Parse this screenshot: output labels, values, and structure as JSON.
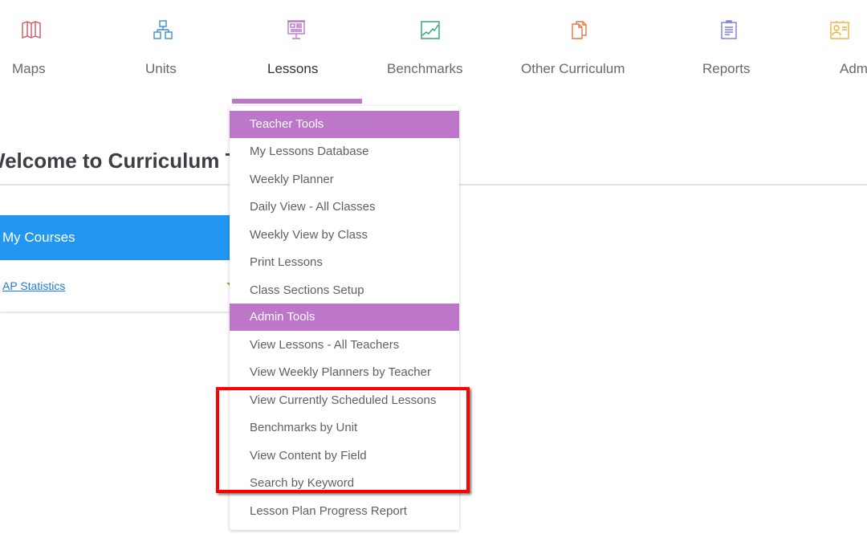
{
  "nav": {
    "items": [
      {
        "label": "Maps",
        "icon": "map-icon",
        "color": "#d9525e"
      },
      {
        "label": "Units",
        "icon": "hierarchy-icon",
        "color": "#3d8fd1"
      },
      {
        "label": "Lessons",
        "icon": "presentation-board-icon",
        "color": "#bc77c8",
        "active": true
      },
      {
        "label": "Benchmarks",
        "icon": "line-chart-icon",
        "color": "#36a87a"
      },
      {
        "label": "Other Curriculum",
        "icon": "documents-icon",
        "color": "#e8773f"
      },
      {
        "label": "Reports",
        "icon": "clipboard-icon",
        "color": "#7a7fdc"
      },
      {
        "label": "Adm",
        "icon": "admin-id-card-icon",
        "color": "#f0b13c"
      }
    ],
    "accent_color": "#bc77c8"
  },
  "page": {
    "welcome_title": "Welcome to Curriculum Trak",
    "welcome_visible": "lcome to Curriculum Tr"
  },
  "courses": {
    "title": "My Courses",
    "header_color": "#2196f3",
    "items": [
      {
        "label": "AP Statistics"
      }
    ]
  },
  "dropdown": {
    "rows": [
      {
        "type": "header",
        "label": "Teacher Tools"
      },
      {
        "type": "item",
        "label": "My Lessons Database"
      },
      {
        "type": "item",
        "label": "Weekly Planner"
      },
      {
        "type": "item",
        "label": "Daily View - All Classes"
      },
      {
        "type": "item",
        "label": "Weekly View by Class"
      },
      {
        "type": "item",
        "label": "Print Lessons"
      },
      {
        "type": "item",
        "label": "Class Sections Setup"
      },
      {
        "type": "header",
        "label": "Admin Tools"
      },
      {
        "type": "item",
        "label": "View Lessons - All Teachers"
      },
      {
        "type": "item",
        "label": "View Weekly Planners by Teacher"
      },
      {
        "type": "item",
        "label": "View Currently Scheduled Lessons",
        "highlighted": true
      },
      {
        "type": "item",
        "label": "Benchmarks by Unit",
        "highlighted": true
      },
      {
        "type": "item",
        "label": "View Content by Field",
        "highlighted": true
      },
      {
        "type": "item",
        "label": "Search by Keyword",
        "highlighted": true
      },
      {
        "type": "item",
        "label": "Lesson Plan Progress Report"
      }
    ]
  },
  "annotation": {
    "highlight_color": "#ff0000"
  }
}
